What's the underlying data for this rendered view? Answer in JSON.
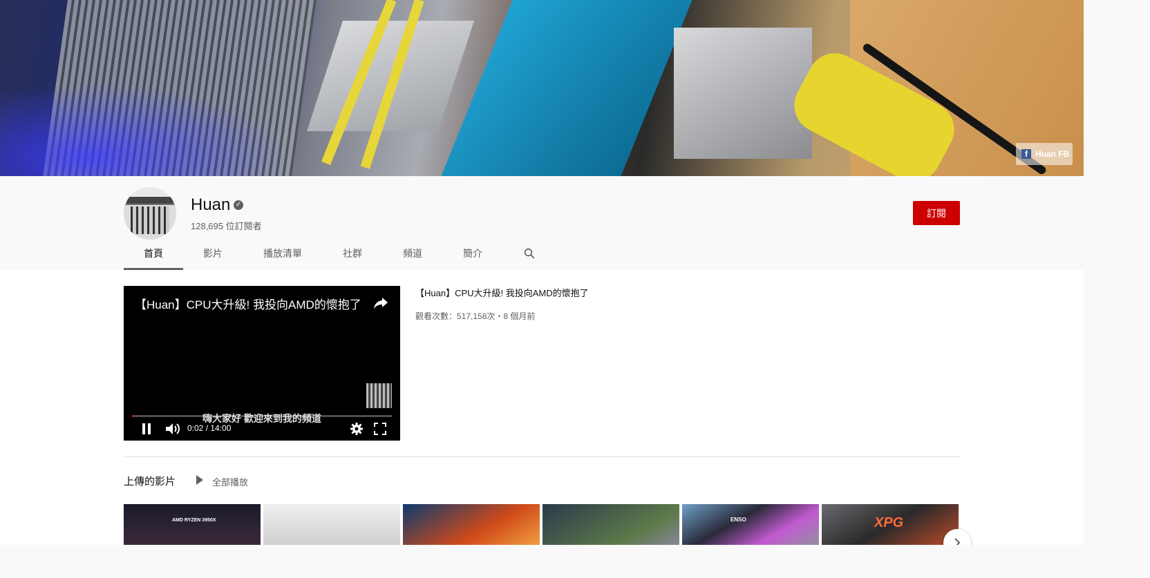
{
  "banner": {
    "fb_link_label": "Huan FB"
  },
  "channel": {
    "name": "Huan",
    "subscribers": "128,695 位訂閱者",
    "subscribe_label": "訂閱"
  },
  "tabs": [
    {
      "label": "首頁",
      "active": true
    },
    {
      "label": "影片"
    },
    {
      "label": "播放清單"
    },
    {
      "label": "社群"
    },
    {
      "label": "頻道"
    },
    {
      "label": "簡介"
    }
  ],
  "featured": {
    "player_title": "【Huan】CPU大升級! 我投向AMD的懷抱了",
    "caption": "嗨大家好  歡迎來到我的頻道",
    "time": "0:02 / 14:00",
    "progress": 0.0024,
    "title": "【Huan】CPU大升級! 我投向AMD的懷抱了",
    "meta": "觀看次數：517,158次・8 個月前"
  },
  "shelf": {
    "title": "上傳的影片",
    "play_all": "全部播放",
    "thumbs": [
      {
        "text": "AMD RYZEN 3950X"
      },
      {
        "text": ""
      },
      {
        "text": ""
      },
      {
        "text": ""
      },
      {
        "text": "ENSO"
      },
      {
        "text": "XPG"
      }
    ]
  },
  "colors": {
    "subscribe": "#cc0000",
    "accent_fb": "#3b5998"
  }
}
